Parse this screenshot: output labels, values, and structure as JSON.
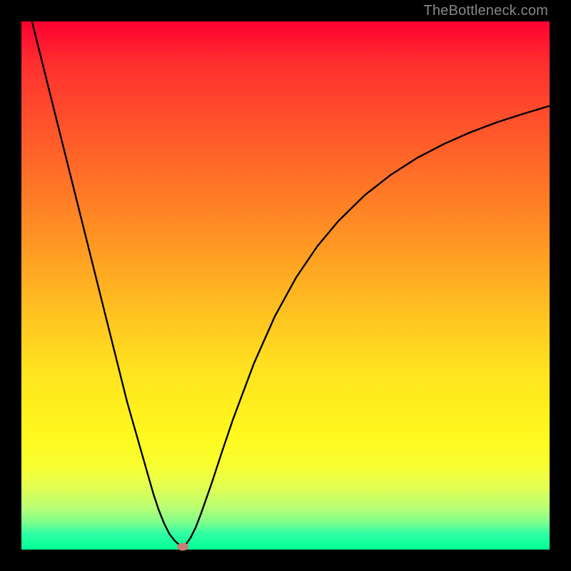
{
  "watermark": "TheBottleneck.com",
  "chart_data": {
    "type": "line",
    "title": "",
    "xlabel": "",
    "ylabel": "",
    "xlim": [
      0,
      100
    ],
    "ylim": [
      0,
      100
    ],
    "grid": false,
    "legend": false,
    "annotations": [],
    "series": [
      {
        "name": "curve",
        "x": [
          0,
          2,
          4,
          6,
          8,
          10,
          12,
          14,
          16,
          18,
          20,
          22,
          24,
          25,
          26,
          27,
          28,
          29,
          30,
          30.5,
          31,
          32,
          33,
          34,
          36,
          38,
          40,
          44,
          48,
          52,
          56,
          60,
          65,
          70,
          75,
          80,
          85,
          90,
          95,
          100
        ],
        "y": [
          108,
          100,
          92,
          84,
          76,
          68,
          60,
          52,
          44,
          36,
          28,
          21,
          14,
          10.5,
          7.5,
          5,
          3,
          1.7,
          0.8,
          0.5,
          0.8,
          2.2,
          4.2,
          6.8,
          12.5,
          18.6,
          24.5,
          35.2,
          44.2,
          51.5,
          57.4,
          62.2,
          67.1,
          71,
          74.2,
          76.8,
          79,
          80.9,
          82.5,
          84
        ]
      }
    ],
    "marker": {
      "x": 30.5,
      "y": 0.5,
      "color": "#cc7d79"
    },
    "background_gradient": {
      "top": "#ff0030",
      "bottom": "#00ff95",
      "stops": [
        "#ff0030",
        "#ff2f2f",
        "#ff5a2a",
        "#ff8a24",
        "#ffb821",
        "#ffe31f",
        "#fff81e",
        "#f8ff30",
        "#e4ff50",
        "#baff74",
        "#7bff8d",
        "#2effa4",
        "#00ff95"
      ]
    }
  }
}
